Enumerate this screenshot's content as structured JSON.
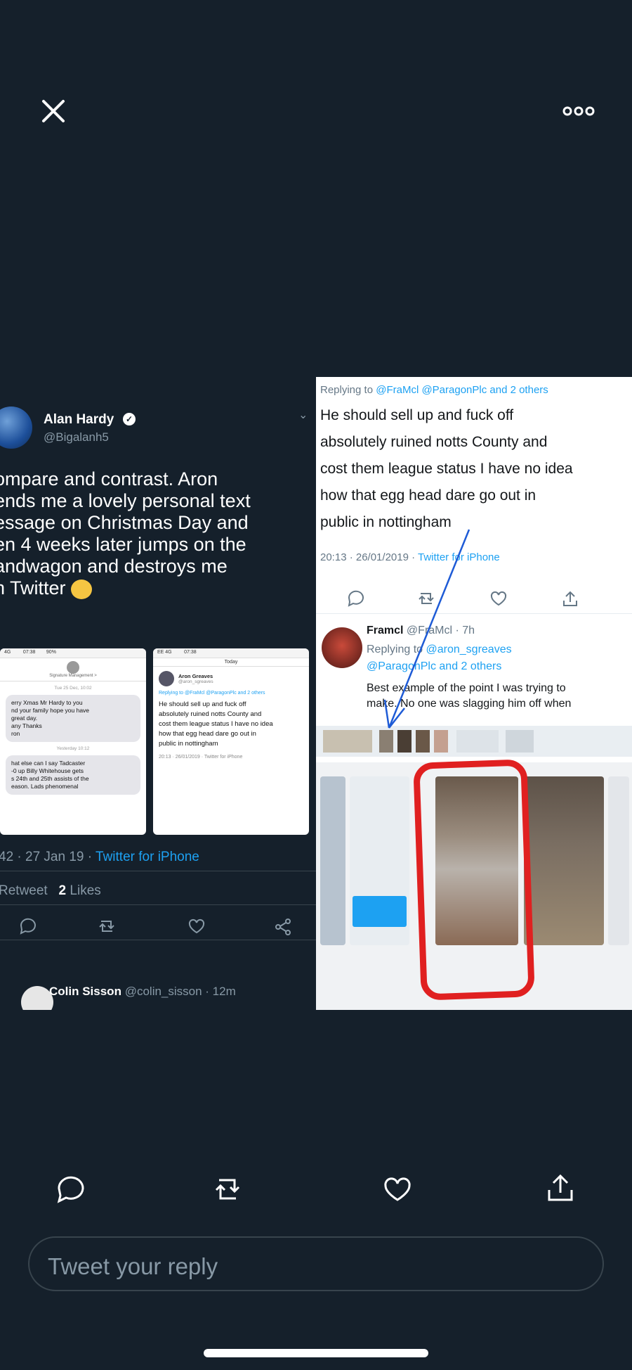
{
  "left_tweet": {
    "name": "Alan Hardy",
    "handle": "@Bigalanh5",
    "body": "ompare and contrast. Aron\nends me a lovely personal text\nessage on Christmas Day and\nen 4 weeks later jumps on the\nandwagon and destroys me\nn Twitter",
    "meta_time": "42 · 27 Jan 19 · ",
    "meta_source": "Twitter for iPhone",
    "stats_retweet": "Retweet",
    "stats_likes_count": "2",
    "stats_likes_label": "Likes",
    "next_reply_name": "Colin Sisson",
    "next_reply_meta": "@colin_sisson · 12m",
    "screenshot1": {
      "header": "Signature Management >",
      "date1": "Tue 25 Dec, 10:02",
      "msg1": "erry Xmas Mr Hardy to you\nnd your family hope you have\ngreat day.\nany Thanks\nron",
      "date2": "Yesterday 10:12",
      "msg2": "hat else can I say Tadcaster\n-0 up Billy Whitehouse gets\ns 24th and 25th assists of the\neason. Lads phenomenal"
    },
    "screenshot2": {
      "header": "Today",
      "user": "Aron Greaves",
      "handle": "@aron_sgreaves",
      "reply": "Replying to @FraMcl @ParagonPlc and 2 others",
      "body": "He should sell up and fuck off\nabsolutely ruined notts County and\ncost them league status I have no idea\nhow that egg head dare go out in\npublic in nottingham",
      "meta": "20:13 · 26/01/2019 · Twitter for iPhone"
    }
  },
  "right_tweet": {
    "replying_label": "Replying to ",
    "replying_targets": "@FraMcl @ParagonPlc and 2 others",
    "body": "He should sell up and fuck off\nabsolutely ruined notts County and\ncost them league status I have no idea\nhow that egg head dare go out in\npublic in nottingham",
    "meta_time": "20:13 · 26/01/2019 · ",
    "meta_source": "Twitter for iPhone",
    "reply_name": "Framcl",
    "reply_meta": "@FraMcl · 7h",
    "reply_replying_label": "Replying to ",
    "reply_replying_targets": "@aron_sgreaves\n@ParagonPlc and 2 others",
    "reply_body": "Best example of the point I was trying to\nmake. No one was slagging him off when"
  },
  "reply_box": {
    "placeholder": "Tweet your reply"
  },
  "colors": {
    "background": "#15202b",
    "accent": "#1da1f2",
    "highlight_circle": "#e02020"
  },
  "icons": [
    "close-icon",
    "more-icon",
    "reply-icon",
    "retweet-icon",
    "like-icon",
    "share-icon"
  ]
}
